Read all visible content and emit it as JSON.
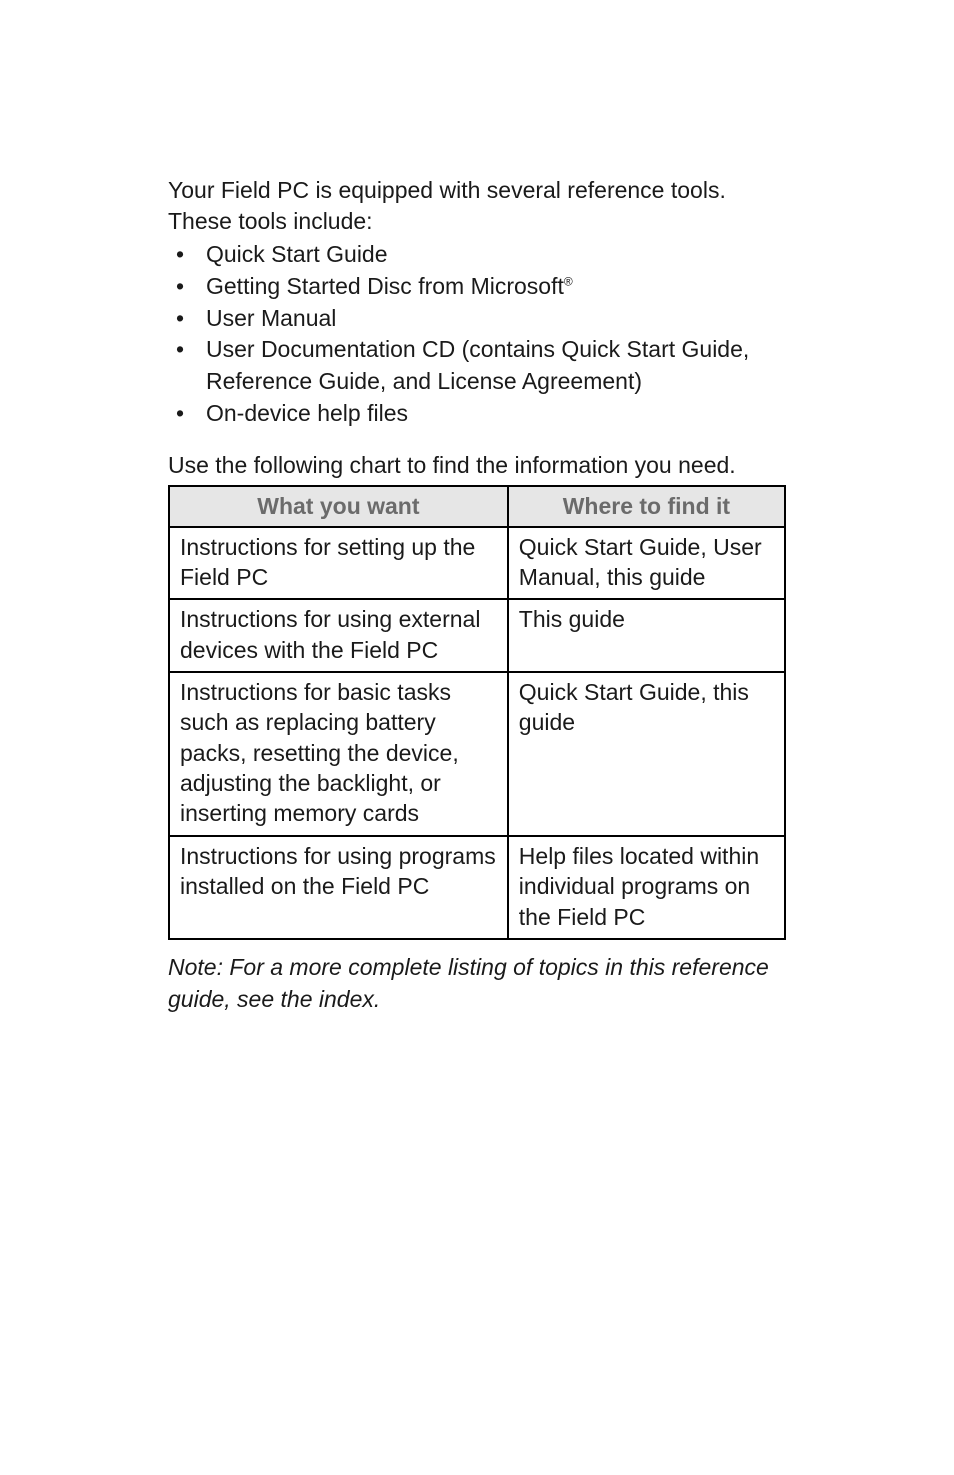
{
  "intro": "Your Field PC is equipped with several reference tools. These tools include:",
  "bullets": [
    "Quick Start Guide",
    "Getting Started Disc from Microsoft",
    "User Manual",
    "User Documentation CD (contains Quick Start Guide, Reference Guide, and License Agreement)",
    "On-device help files"
  ],
  "superscript": "®",
  "lead": "Use the following chart to find the information you need.",
  "table": {
    "headers": [
      "What you want",
      "Where to find it"
    ],
    "rows": [
      [
        "Instructions for setting up the Field PC",
        "Quick Start Guide, User Manual, this guide"
      ],
      [
        "Instructions for using external devices with the Field PC",
        "This guide"
      ],
      [
        "Instructions for basic tasks such as replacing battery packs, resetting the device, adjusting the backlight, or inserting memory cards",
        "Quick Start Guide, this guide"
      ],
      [
        "Instructions for using programs installed on the Field PC",
        "Help files located within individual programs on the Field PC"
      ]
    ]
  },
  "note": "Note: For a more complete listing of topics in this reference guide, see the index."
}
